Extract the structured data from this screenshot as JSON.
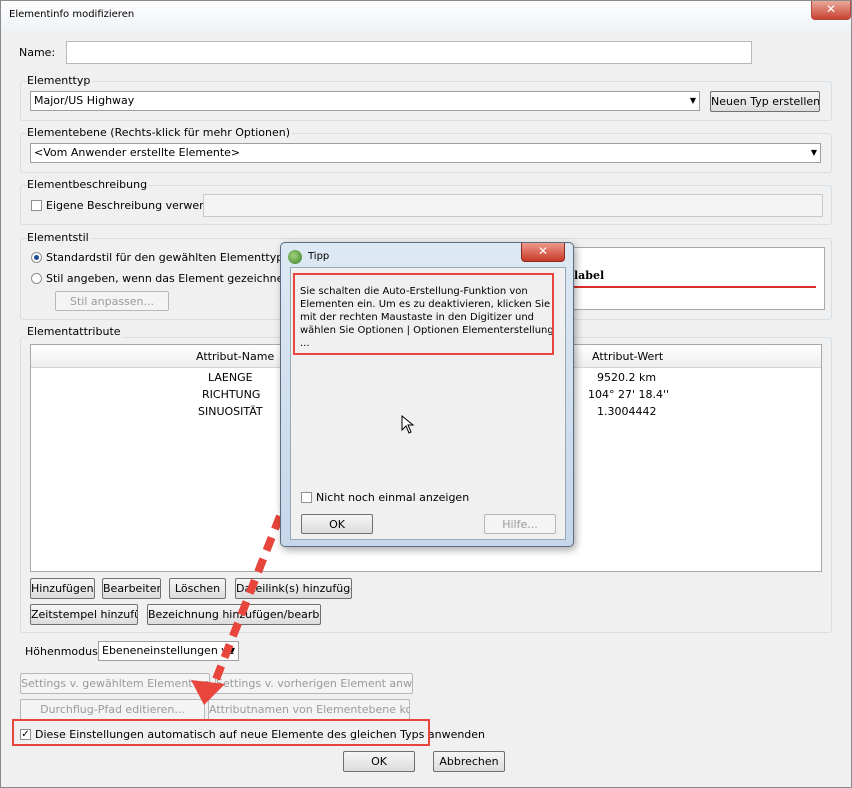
{
  "window": {
    "title": "Elementinfo modifizieren",
    "close_glyph": "✕"
  },
  "name": {
    "label": "Name:",
    "value": ""
  },
  "elementtyp": {
    "label": "Elementtyp",
    "selected": "Major/US Highway",
    "new_type_button": "Neuen Typ erstellen..."
  },
  "elementebene": {
    "label": "Elementebene (Rechts-klick für mehr Optionen)",
    "selected": "<Vom Anwender erstellte Elemente>"
  },
  "beschreibung": {
    "label": "Elementbeschreibung",
    "checkbox_label": "Eigene Beschreibung verwenden",
    "checked": false,
    "value": ""
  },
  "stil": {
    "label": "Elementstil",
    "radio_default": "Standardstil für den gewählten Elementtyp verwen",
    "radio_custom": "Stil angeben, wenn das Element gezeichnet wir",
    "customize_button": "Stil anpassen...",
    "preview_label": "label",
    "line_color": "#d9302c"
  },
  "attribute": {
    "label": "Elementattribute",
    "headers": [
      "Attribut-Name",
      "Attribut-Wert"
    ],
    "rows": [
      {
        "name": "LAENGE",
        "value": "9520.2 km"
      },
      {
        "name": "RICHTUNG",
        "value": "104° 27' 18.4''"
      },
      {
        "name": "SINUOSITÄT",
        "value": "1.3004442"
      }
    ],
    "buttons_row1": [
      "Hinzufügen...",
      "Bearbeiten...",
      "Löschen",
      "Dateilink(s) hinzufügen"
    ],
    "buttons_row2": [
      "Zeitstempel hinzufügen",
      "Bezeichnung hinzufügen/bearbeiten..."
    ]
  },
  "hoehen": {
    "label": "Höhenmodus:",
    "selected": "Ebeneneinstellungen ve"
  },
  "bottom_buttons": {
    "apply_selected": "Settings v. gewähltem Element anwenden",
    "apply_previous": "Settings v. vorherigen Element anwenden",
    "flythrough": "Durchflug-Pfad editieren...",
    "copy_attr_names": "Attributnamen von Elementebene kopieren"
  },
  "auto_apply": {
    "label": "Diese Einstellungen automatisch auf neue Elemente des gleichen Typs anwenden",
    "checked": true
  },
  "ok": "OK",
  "cancel": "Abbrechen",
  "tipp": {
    "title": "Tipp",
    "message": "Sie schalten die Auto-Erstellung-Funktion von Elementen ein. Um es zu deaktivieren, klicken Sie mit der rechten Maustaste in den Digitizer und wählen Sie Optionen | Optionen Elementerstellung ...",
    "dont_show": "Nicht noch einmal anzeigen",
    "ok": "OK",
    "help": "Hilfe..."
  },
  "highlight_color": "#e8453c",
  "accent_color": "#1c4f9c"
}
